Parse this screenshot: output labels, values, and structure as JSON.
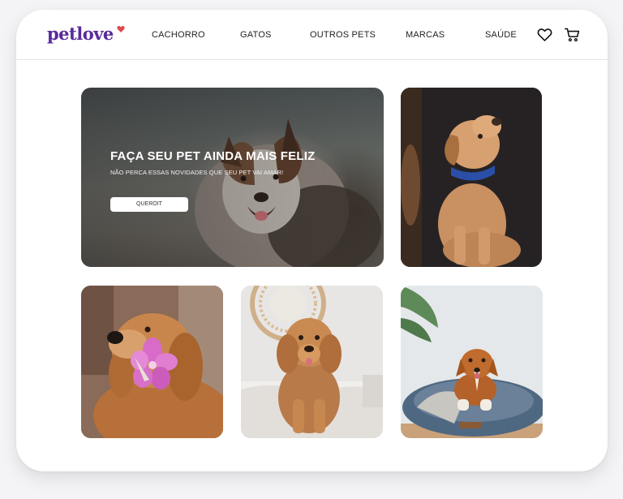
{
  "brand": {
    "name": "petlove",
    "accent": "#5a2a9c",
    "heart_color": "#e0484d"
  },
  "nav": {
    "items": [
      {
        "label": "CACHORRO"
      },
      {
        "label": "GATOS"
      },
      {
        "label": "OUTROS PETS"
      },
      {
        "label": "MARCAS"
      },
      {
        "label": "SAÚDE"
      }
    ],
    "icons": [
      "heart-icon",
      "cart-icon"
    ]
  },
  "hero": {
    "title": "FAÇA SEU PET AINDA MAIS FELIZ",
    "subtitle": "NÃO PERCA ESSAS NOVIDADES QUE SEU PET VAI AMAR!",
    "button_label": "QUEROIT"
  },
  "gallery": {
    "photos": [
      {
        "subject": "labrador-puppy"
      },
      {
        "subject": "golden-retriever-with-flower"
      },
      {
        "subject": "goldendoodle-on-bed"
      },
      {
        "subject": "dog-in-pet-bed"
      }
    ]
  }
}
